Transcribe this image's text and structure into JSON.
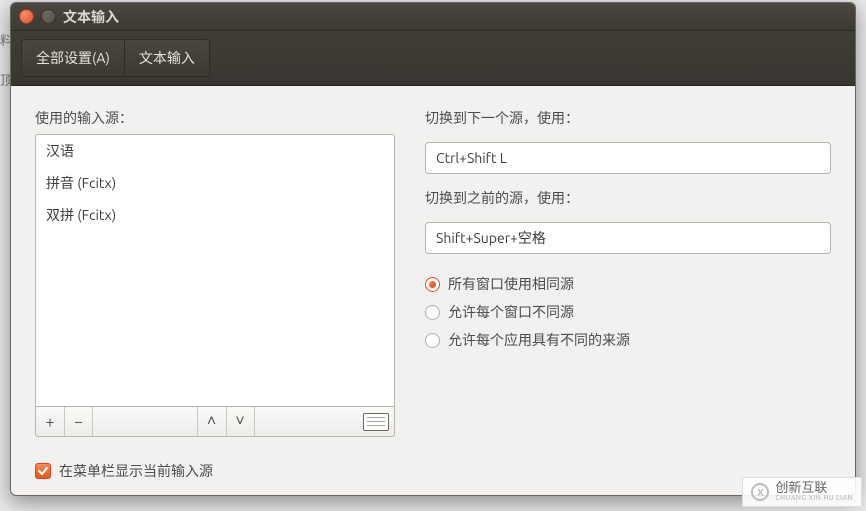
{
  "window": {
    "title": "文本输入"
  },
  "toolbar": {
    "all_settings": "全部设置(A)",
    "text_entry": "文本输入"
  },
  "left": {
    "label": "使用的输入源：",
    "sources": [
      "汉语",
      "拼音 (Fcitx)",
      "双拼 (Fcitx)"
    ]
  },
  "right": {
    "next_label": "切换到下一个源，使用：",
    "next_value": "Ctrl+Shift L",
    "prev_label": "切换到之前的源，使用：",
    "prev_value": "Shift+Super+空格",
    "radios": {
      "same": "所有窗口使用相同源",
      "per_window": "允许每个窗口不同源",
      "per_app": "允许每个应用具有不同的来源",
      "selected": "same"
    }
  },
  "footer": {
    "show_in_menubar": "在菜单栏显示当前输入源",
    "checked": true
  },
  "icons": {
    "add": "+",
    "remove": "−",
    "up": "˄",
    "down": "˅"
  },
  "watermark": {
    "brand": "创新互联",
    "sub": "CHUANG XIN HU LIAN"
  }
}
